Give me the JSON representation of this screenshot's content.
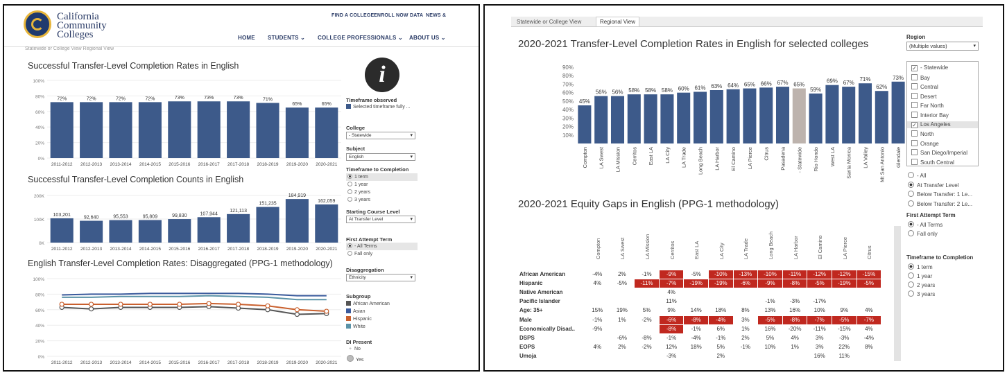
{
  "left": {
    "logo": {
      "line1": "California",
      "line2": "Community",
      "line3": "Colleges"
    },
    "topnav": [
      "FIND A COLLEGE",
      "ENROLL NOW",
      "DATA",
      "NEWS &"
    ],
    "mainnav": [
      "HOME",
      "STUDENTS ⌄",
      "COLLEGE PROFESSIONALS ⌄",
      "ABOUT US ⌄"
    ],
    "tabs_strip": "Statewide or College View   Regional View",
    "info_icon_glyph": "i",
    "chart1": {
      "title": "Successful Transfer-Level Completion Rates in English",
      "type": "bar",
      "categories": [
        "2011-2012",
        "2012-2013",
        "2013-2014",
        "2014-2015",
        "2015-2016",
        "2016-2017",
        "2017-2018",
        "2018-2019",
        "2019-2020",
        "2020-2021"
      ],
      "values": [
        72,
        72,
        72,
        72,
        73,
        73,
        73,
        71,
        65,
        65
      ],
      "labels": [
        "72%",
        "72%",
        "72%",
        "72%",
        "73%",
        "73%",
        "73%",
        "71%",
        "65%",
        "65%"
      ],
      "yticks": [
        "100%",
        "80%",
        "60%",
        "40%",
        "20%",
        "0%"
      ],
      "ylim": [
        0,
        100
      ]
    },
    "chart2": {
      "title": "Successful Transfer-Level Completion Counts in English",
      "type": "bar",
      "categories": [
        "2011-2012",
        "2012-2013",
        "2013-2014",
        "2014-2015",
        "2015-2016",
        "2016-2017",
        "2017-2018",
        "2018-2019",
        "2019-2020",
        "2020-2021"
      ],
      "values": [
        103201,
        92640,
        95553,
        95809,
        99830,
        107944,
        121113,
        151235,
        184919,
        162059
      ],
      "labels": [
        "103,201",
        "92,640",
        "95,553",
        "95,809",
        "99,830",
        "107,944",
        "121,113",
        "151,235",
        "184,919",
        "162,059"
      ],
      "yticks": [
        "200K",
        "100K",
        "0K"
      ],
      "ylim": [
        0,
        200000
      ]
    },
    "chart3": {
      "title": "English Transfer-Level Completion Rates: Disaggregated (PPG-1 methodology)",
      "type": "line",
      "categories": [
        "2011-2012",
        "2012-2013",
        "2013-2014",
        "2014-2015",
        "2015-2016",
        "2016-2017",
        "2017-2018",
        "2018-2019",
        "2019-2020",
        "2020-2021"
      ],
      "yticks": [
        "100%",
        "80%",
        "60%",
        "40%",
        "20%",
        "0%"
      ],
      "ylim": [
        0,
        100
      ],
      "series": [
        {
          "name": "African American",
          "color": "#555555",
          "values": [
            63,
            61,
            63,
            63,
            63,
            64,
            62,
            60,
            54,
            55
          ]
        },
        {
          "name": "Asian",
          "color": "#3a5a9c",
          "values": [
            79,
            80,
            80,
            81,
            81,
            81,
            81,
            80,
            78,
            78
          ]
        },
        {
          "name": "Hispanic",
          "color": "#c9602e",
          "values": [
            67,
            67,
            67,
            67,
            67,
            68,
            67,
            65,
            60,
            58
          ]
        },
        {
          "name": "White",
          "color": "#5b93a8",
          "values": [
            76,
            76,
            77,
            77,
            77,
            78,
            77,
            76,
            73,
            73
          ]
        }
      ]
    },
    "controls": {
      "timeframe_label": "Timeframe observed",
      "timeframe_legend": "Selected timeframe fully ...",
      "college_label": "College",
      "college_value": "- Statewide",
      "subject_label": "Subject",
      "subject_value": "English",
      "ttc_label": "Timeframe to Completion",
      "ttc_options": [
        "1 term",
        "1 year",
        "2 years",
        "3 years"
      ],
      "start_label": "Starting Course Level",
      "start_value": "At Transfer Level",
      "fat_label": "First Attempt Term",
      "fat_options": [
        "- All Terms",
        "Fall only"
      ],
      "disagg_label": "Disaggregation",
      "disagg_value": "Ethnicity",
      "subgroup_label": "Subgroup",
      "subgroups": [
        "African American",
        "Asian",
        "Hispanic",
        "White"
      ],
      "di_label": "DI Present",
      "di_options": [
        "No",
        "Yes"
      ]
    }
  },
  "right": {
    "tabs": [
      "Statewide or College View",
      "Regional View"
    ],
    "chart1": {
      "title": "2020-2021 Transfer-Level Completion Rates in English for selected colleges",
      "type": "bar",
      "categories": [
        "Compton",
        "LA Swest",
        "LA Mission",
        "Cerritos",
        "East LA",
        "LA City",
        "LA Trade",
        "Long Beach",
        "LA Harbor",
        "El Camino",
        "LA Pierce",
        "Citrus",
        "Pasadena",
        "- Statewide",
        "Rio Hondo",
        "West LA",
        "Santa Monica",
        "LA Valley",
        "Mt San Antonio",
        "Glendale"
      ],
      "values": [
        45,
        56,
        56,
        58,
        58,
        58,
        60,
        61,
        63,
        64,
        65,
        66,
        67,
        65,
        59,
        69,
        67,
        71,
        62,
        73
      ],
      "labels": [
        "45%",
        "56%",
        "56%",
        "58%",
        "58%",
        "58%",
        "60%",
        "61%",
        "63%",
        "64%",
        "65%",
        "66%",
        "67%",
        "65%",
        "59%",
        "69%",
        "67%",
        "71%",
        "62%",
        "73%"
      ],
      "highlight_color": "#bdb3ad",
      "bar_color": "#3d5a8a",
      "yticks": [
        "90%",
        "80%",
        "70%",
        "60%",
        "50%",
        "40%",
        "30%",
        "20%",
        "10%"
      ],
      "ylim": [
        0,
        90
      ]
    },
    "region": {
      "label": "Region",
      "value": "(Multiple values)",
      "options": [
        {
          "label": "- Statewide",
          "checked": true
        },
        {
          "label": "Bay",
          "checked": false
        },
        {
          "label": "Central",
          "checked": false
        },
        {
          "label": "Desert",
          "checked": false
        },
        {
          "label": "Far North",
          "checked": false
        },
        {
          "label": "Interior Bay",
          "checked": false
        },
        {
          "label": "Los Angeles",
          "checked": true
        },
        {
          "label": "North",
          "checked": false
        },
        {
          "label": "Orange",
          "checked": false
        },
        {
          "label": "San Diego/Imperial",
          "checked": false
        },
        {
          "label": "South Central",
          "checked": false
        }
      ]
    },
    "level_options": [
      "- All",
      "At Transfer Level",
      "Below Transfer: 1 Le...",
      "Below Transfer: 2 Le..."
    ],
    "fat_label": "First Attempt Term",
    "fat_options": [
      "- All Terms",
      "Fall only"
    ],
    "ttc_label": "Timeframe to Completion",
    "ttc_options": [
      "1 term",
      "1 year",
      "2 years",
      "3 years"
    ],
    "table": {
      "title": "2020-2021 Equity Gaps in English (PPG-1 methodology)",
      "columns": [
        "Compton",
        "LA Swest",
        "LA Mission",
        "Cerritos",
        "East LA",
        "LA City",
        "LA Trade",
        "Long Beach",
        "LA Harbor",
        "El Camino",
        "LA Pierce",
        "Citrus"
      ],
      "rows": [
        {
          "label": "African American",
          "cells": [
            "-4%",
            "2%",
            "-1%",
            "-9%",
            "-5%",
            "-10%",
            "-13%",
            "-10%",
            "-11%",
            "-12%",
            "-12%",
            "-15%"
          ],
          "flags": [
            0,
            0,
            0,
            1,
            0,
            1,
            1,
            1,
            1,
            1,
            1,
            1
          ]
        },
        {
          "label": "Hispanic",
          "cells": [
            "4%",
            "-5%",
            "-11%",
            "-7%",
            "-19%",
            "-19%",
            "-6%",
            "-9%",
            "-8%",
            "-5%",
            "-19%",
            "-5%"
          ],
          "flags": [
            0,
            0,
            1,
            1,
            1,
            1,
            1,
            1,
            1,
            1,
            1,
            1
          ]
        },
        {
          "label": "Native American",
          "cells": [
            "",
            "",
            "",
            "4%",
            "",
            "",
            "",
            "",
            "",
            "",
            "",
            ""
          ],
          "flags": [
            0,
            0,
            0,
            0,
            0,
            0,
            0,
            0,
            0,
            0,
            0,
            0
          ]
        },
        {
          "label": "Pacific Islander",
          "cells": [
            "",
            "",
            "",
            "11%",
            "",
            "",
            "",
            "-1%",
            "-3%",
            "-17%",
            "",
            ""
          ],
          "flags": [
            0,
            0,
            0,
            0,
            0,
            0,
            0,
            0,
            0,
            0,
            0,
            0
          ]
        },
        {
          "label": "Age: 35+",
          "cells": [
            "15%",
            "19%",
            "5%",
            "9%",
            "14%",
            "18%",
            "8%",
            "13%",
            "16%",
            "10%",
            "9%",
            "4%"
          ],
          "flags": [
            0,
            0,
            0,
            0,
            0,
            0,
            0,
            0,
            0,
            0,
            0,
            0
          ]
        },
        {
          "label": "Male",
          "cells": [
            "-1%",
            "1%",
            "-2%",
            "-6%",
            "-8%",
            "-4%",
            "3%",
            "-5%",
            "-8%",
            "-7%",
            "-5%",
            "-7%"
          ],
          "flags": [
            0,
            0,
            0,
            1,
            1,
            1,
            0,
            1,
            1,
            1,
            1,
            1
          ]
        },
        {
          "label": "Economically Disad..",
          "cells": [
            "-9%",
            "",
            "",
            "-8%",
            "-1%",
            "6%",
            "1%",
            "16%",
            "-20%",
            "-11%",
            "-15%",
            "4%"
          ],
          "flags": [
            0,
            0,
            0,
            1,
            0,
            0,
            0,
            0,
            0,
            0,
            0,
            0
          ]
        },
        {
          "label": "DSPS",
          "cells": [
            "",
            "-6%",
            "-8%",
            "-1%",
            "-4%",
            "-1%",
            "2%",
            "5%",
            "4%",
            "3%",
            "-3%",
            "-4%"
          ],
          "flags": [
            0,
            0,
            0,
            0,
            0,
            0,
            0,
            0,
            0,
            0,
            0,
            0
          ]
        },
        {
          "label": "EOPS",
          "cells": [
            "4%",
            "2%",
            "-2%",
            "12%",
            "18%",
            "5%",
            "-1%",
            "10%",
            "1%",
            "3%",
            "22%",
            "8%"
          ],
          "flags": [
            0,
            0,
            0,
            0,
            0,
            0,
            0,
            0,
            0,
            0,
            0,
            0
          ]
        },
        {
          "label": "Umoja",
          "cells": [
            "",
            "",
            "",
            "-3%",
            "",
            "2%",
            "",
            "",
            "",
            "16%",
            "11%",
            ""
          ],
          "flags": [
            0,
            0,
            0,
            0,
            0,
            0,
            0,
            0,
            0,
            0,
            0,
            0
          ]
        }
      ],
      "flag_color": "#c0281f"
    }
  },
  "colors": {
    "bar": "#3d5a8a",
    "navy": "#2a3b66"
  }
}
